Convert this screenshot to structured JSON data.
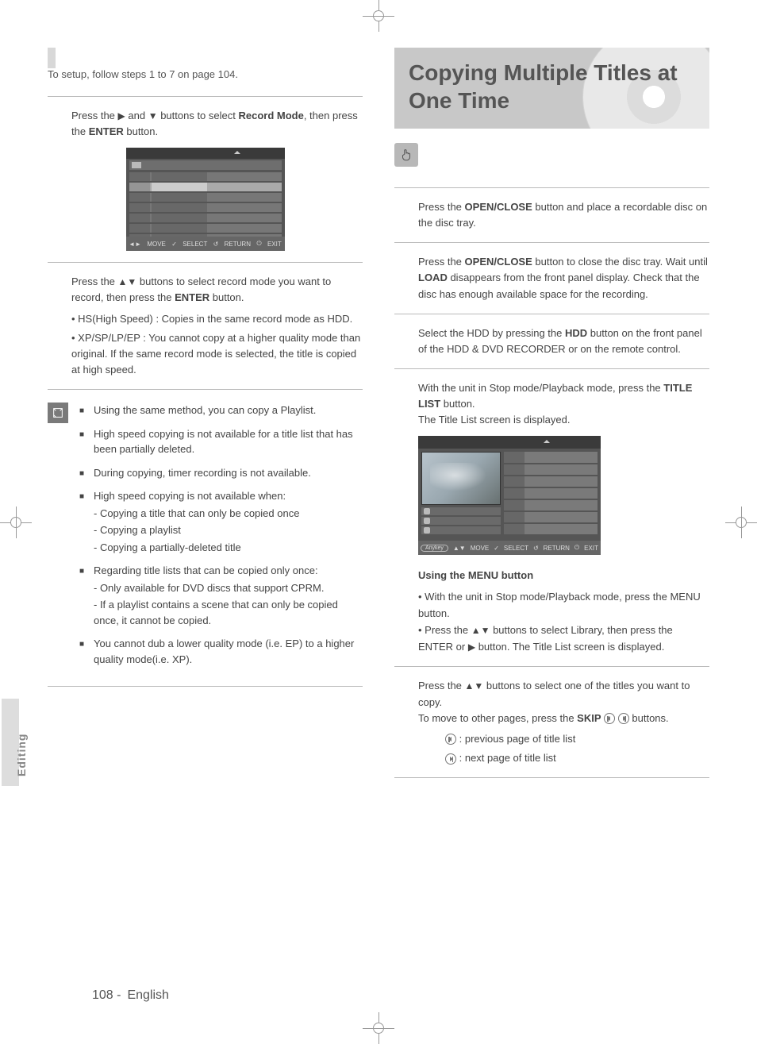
{
  "page_number": "108 -",
  "language": "English",
  "side_tab": "Editing",
  "left": {
    "setup_line": "To setup, follow steps 1 to 7 on page 104.",
    "step8_a": "Press the ",
    "step8_b": " and ",
    "step8_c": " buttons to select ",
    "step8_term": "Record Mode",
    "step8_d": ", then press the ",
    "step8_btn": "ENTER",
    "step8_e": " button.",
    "scr1": {
      "footer": [
        "MOVE",
        "SELECT",
        "RETURN",
        "EXIT"
      ]
    },
    "step9_a": "Press the ",
    "step9_b": " buttons to select record mode you want to record, then press the ",
    "step9_btn": "ENTER",
    "step9_c": " button.",
    "hs_line": "HS(High Speed) : Copies in the same record mode as HDD.",
    "xp_line": "XP/SP/LP/EP : You cannot copy at a higher quality mode than original. If the same record mode is selected, the title is copied at high speed.",
    "note_label": "NOTE",
    "notes": [
      "Using the same method, you can copy a Playlist.",
      "High speed copying is not available for a title list that has been partially deleted.",
      "During copying, timer recording is not available.",
      "High speed copying is not available when:",
      "Regarding title lists that can be copied only once:",
      "You cannot dub a lower quality mode (i.e. EP) to a higher quality mode(i.e. XP)."
    ],
    "hs_sub": [
      "- Copying a title that can only be copied once",
      "- Copying a playlist",
      "- Copying a partially-deleted title"
    ],
    "once_sub": [
      "- Only available for DVD discs that support CPRM.",
      "- If a playlist contains a scene that can only be copied once, it cannot be copied."
    ]
  },
  "right": {
    "title": "Copying Multiple Titles at One Time",
    "step1_a": "Press the ",
    "step1_btn": "OPEN/CLOSE",
    "step1_b": " button and place a recordable disc on the disc tray.",
    "step2_a": " Press the ",
    "step2_btn": "OPEN/CLOSE",
    "step2_b": " button to close the disc tray. Wait until ",
    "step2_load": "LOAD",
    "step2_c": " disappears from the front panel display. Check that the disc has enough available space for the recording.",
    "step3_a": "Select the HDD by pressing the ",
    "step3_btn": "HDD",
    "step3_b": " button on the front panel of the HDD & DVD RECORDER or on the remote control.",
    "step4_a": "With the unit in Stop mode/Playback mode, press the ",
    "step4_btn": "TITLE LIST",
    "step4_b": " button.",
    "step4_c": "The Title List screen is displayed.",
    "scr2": {
      "footer_pill": "Anykey",
      "footer": [
        "MOVE",
        "SELECT",
        "RETURN",
        "EXIT"
      ]
    },
    "using_menu_heading": "Using the MENU button",
    "um1_a": "With the unit in Stop mode/Playback mode, press the ",
    "um1_btn": "MENU",
    "um1_b": " button.",
    "um2_a": "Press the ",
    "um2_b": " buttons to select ",
    "um2_term": "Library",
    "um2_c": ", then press the ",
    "um2_btn": "ENTER",
    "um2_d": " or ",
    "um2_e": " button. The Title List screen is displayed.",
    "step5_a": "Press the ",
    "step5_b": " buttons to select one of the titles you want to copy.",
    "step5_c": "To move to other pages, press the ",
    "step5_skip": "SKIP",
    "step5_d": " buttons.",
    "skip_prev": " : previous page of title list",
    "skip_next": " : next page of title list"
  }
}
